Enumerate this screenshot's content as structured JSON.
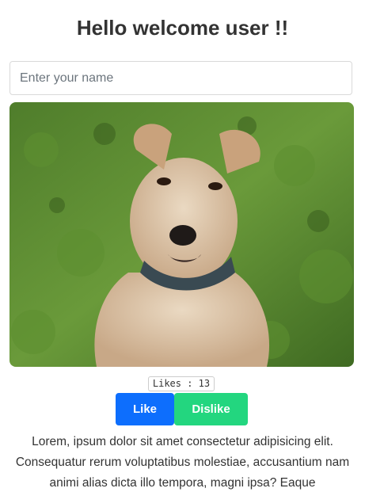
{
  "header": {
    "title": "Hello welcome user !!"
  },
  "name_input": {
    "placeholder": "Enter your name",
    "value": ""
  },
  "image": {
    "subject": "dog-photo"
  },
  "likes": {
    "text": "Likes : 13",
    "count": 13
  },
  "actions": {
    "like_label": "Like",
    "dislike_label": "Dislike"
  },
  "description": {
    "text": "Lorem, ipsum dolor sit amet consectetur adipisicing elit. Consequatur rerum voluptatibus molestiae, accusantium nam animi alias dicta illo tempora, magni ipsa? Eaque"
  },
  "colors": {
    "like": "#0d6efd",
    "dislike": "#23d67f",
    "title": "#333333"
  }
}
